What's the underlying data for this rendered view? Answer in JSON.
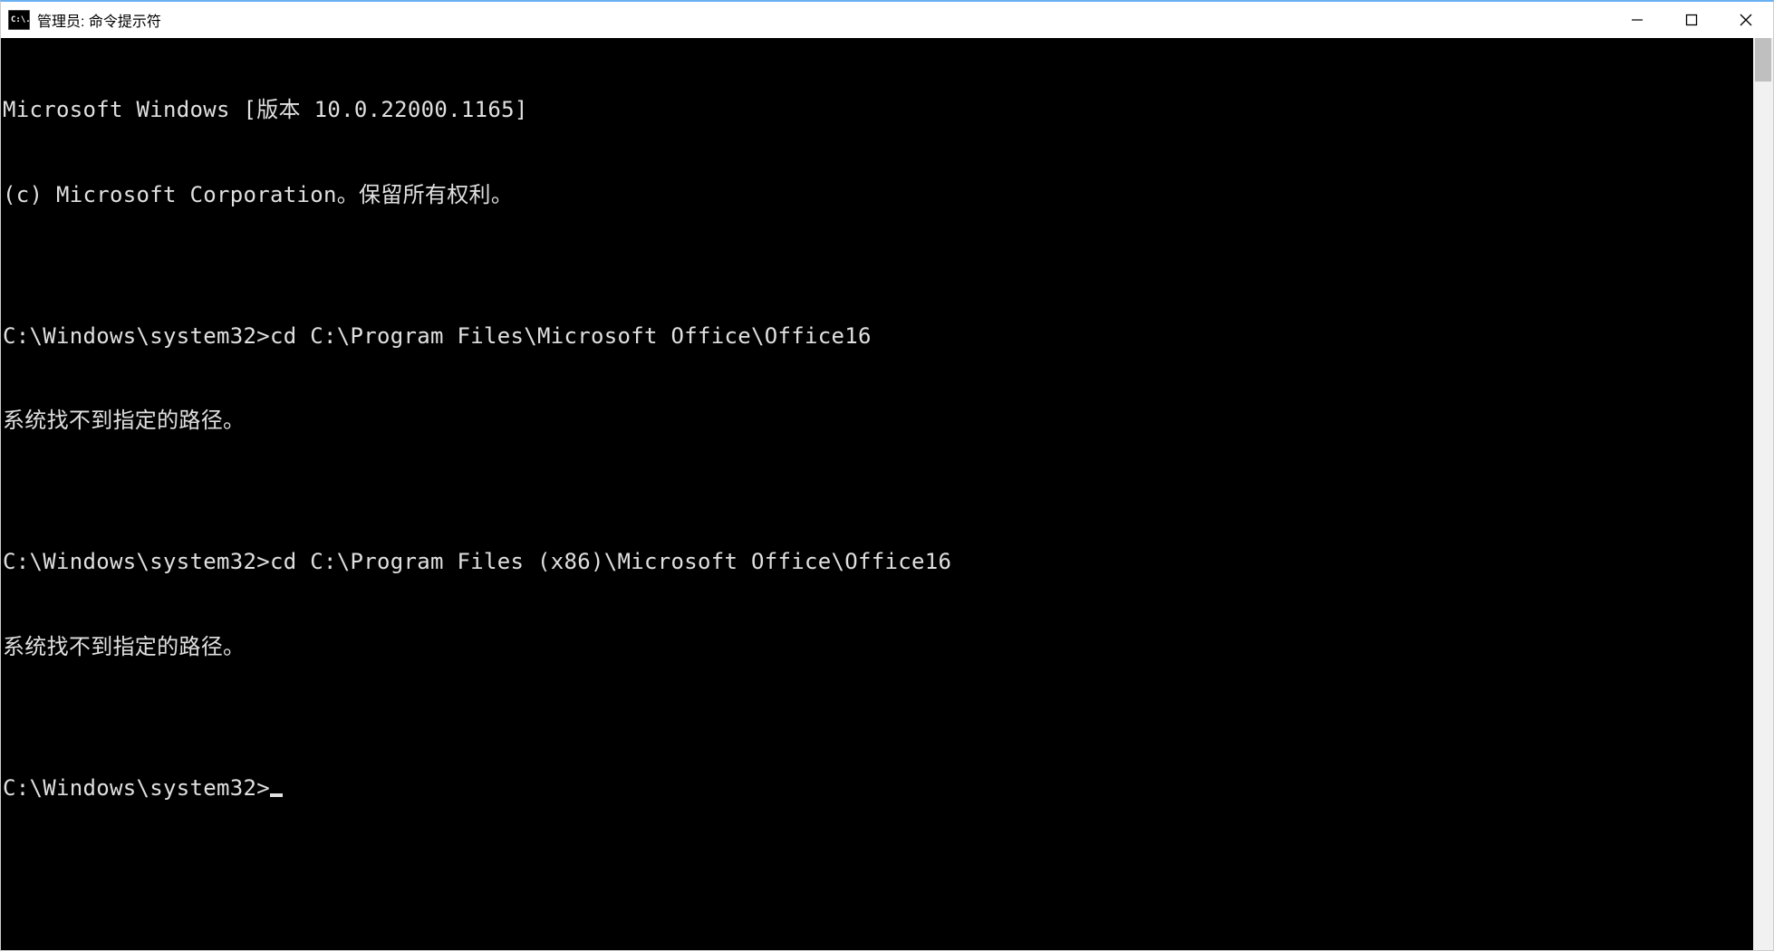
{
  "window": {
    "title": "管理员: 命令提示符"
  },
  "terminal": {
    "lines": [
      "Microsoft Windows [版本 10.0.22000.1165]",
      "(c) Microsoft Corporation。保留所有权利。",
      "",
      "C:\\Windows\\system32>cd C:\\Program Files\\Microsoft Office\\Office16",
      "系统找不到指定的路径。",
      "",
      "C:\\Windows\\system32>cd C:\\Program Files (x86)\\Microsoft Office\\Office16",
      "系统找不到指定的路径。",
      ""
    ],
    "current_prompt": "C:\\Windows\\system32>"
  }
}
